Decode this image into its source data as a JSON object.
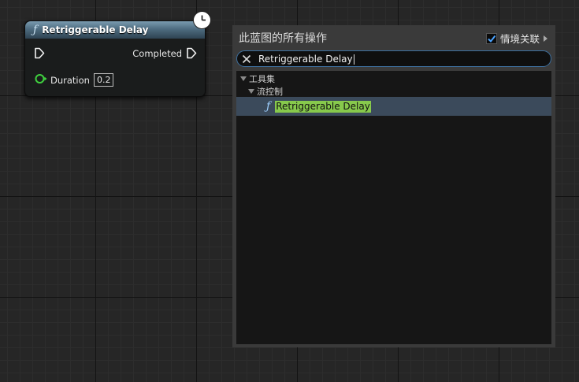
{
  "node": {
    "title": "Retriggerable Delay",
    "output_exec_label": "Completed",
    "duration_label": "Duration",
    "duration_value": "0.2",
    "header_color": "#5a7a90",
    "func_icon": "function-icon"
  },
  "palette": {
    "title": "此蓝图的所有操作",
    "context_sensitive_label": "情境关联",
    "context_sensitive_checked": true,
    "search_value": "Retriggerable Delay",
    "categories": [
      {
        "label": "工具集"
      },
      {
        "label": "流控制"
      }
    ],
    "result_item": {
      "label": "Retriggerable Delay",
      "highlight_color": "#87c94c"
    }
  }
}
